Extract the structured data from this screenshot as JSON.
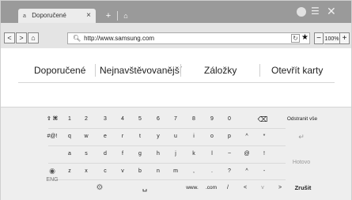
{
  "titlebar": {
    "tab_label": "Doporučené",
    "tab_icon": "a",
    "tab_close": "×",
    "new_tab": "+",
    "home_glyph": "⌂",
    "menu_glyph": "☰",
    "close_glyph": "✕"
  },
  "navbar": {
    "back": "<",
    "forward": ">",
    "home": "⌂",
    "url": "http://www.samsung.com",
    "refresh": "↻",
    "bookmark": "★",
    "zoom_minus": "−",
    "zoom_value": "100%",
    "zoom_plus": "+"
  },
  "quick_tabs": [
    "Doporučené",
    "Nejnavštěvovanější",
    "Záložky",
    "Otevřít karty"
  ],
  "keyboard": {
    "row1": [
      "⇧ ⌘",
      "1",
      "2",
      "3",
      "4",
      "5",
      "6",
      "7",
      "8",
      "9",
      "0",
      "⌫",
      "Odstranit vše"
    ],
    "row2": [
      "#@!",
      "q",
      "w",
      "e",
      "r",
      "t",
      "y",
      "u",
      "i",
      "o",
      "p",
      "^",
      "*",
      "↵"
    ],
    "row3": [
      "a",
      "s",
      "d",
      "f",
      "g",
      "h",
      "j",
      "k",
      "l",
      "~",
      "@",
      "!",
      "Hotovo"
    ],
    "row4": [
      "z",
      "x",
      "c",
      "v",
      "b",
      "n",
      "m",
      ",",
      ".",
      "?",
      "^",
      "-"
    ],
    "row5": [
      "⚙",
      "␣",
      "www.",
      ".com",
      "/",
      "<",
      "v",
      ">",
      "Zrušit"
    ],
    "lang_icon": "◉",
    "lang_label": "ENG"
  },
  "colors": {
    "titlebar": "#9a9a9a",
    "navbar": "#e4e4e4",
    "keyboard_bg": "#eeeeee"
  }
}
